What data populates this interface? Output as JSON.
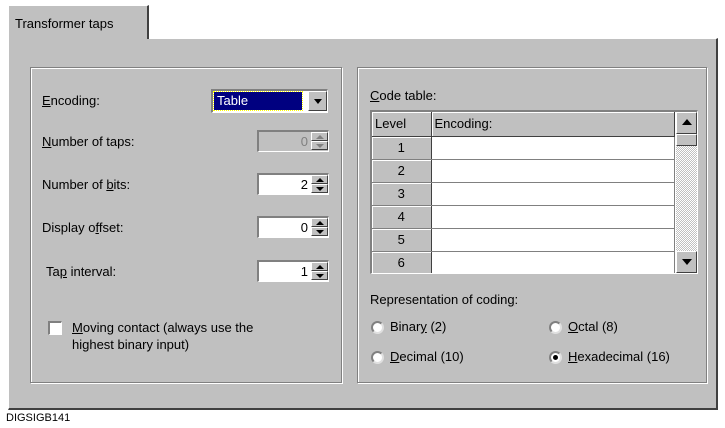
{
  "tab": {
    "label": "Transformer taps"
  },
  "left": {
    "encoding_label": "Encoding:",
    "encoding_value": "Table",
    "taps_label": "Number of taps:",
    "taps_value": "0",
    "bits_label": "Number of bits:",
    "bits_value": "2",
    "offset_label": "Display offset:",
    "offset_value": "0",
    "interval_label": "Tap interval:",
    "interval_value": "1",
    "moving_contact_line1": "Moving contact (always use the",
    "moving_contact_line2": "highest binary input)",
    "moving_contact_checked": false
  },
  "right": {
    "code_table_label": "Code table:",
    "columns": [
      "Level",
      "Encoding:"
    ],
    "rows": [
      {
        "level": "1",
        "encoding": ""
      },
      {
        "level": "2",
        "encoding": ""
      },
      {
        "level": "3",
        "encoding": ""
      },
      {
        "level": "4",
        "encoding": ""
      },
      {
        "level": "5",
        "encoding": ""
      },
      {
        "level": "6",
        "encoding": ""
      }
    ],
    "representation_label": "Representation of coding:",
    "options": {
      "binary": "Binary (2)",
      "octal": "Octal (8)",
      "decimal": "Decimal (10)",
      "hex": "Hexadecimal (16)"
    },
    "selected_option": "hex"
  },
  "footer": "DIGSIGB141"
}
